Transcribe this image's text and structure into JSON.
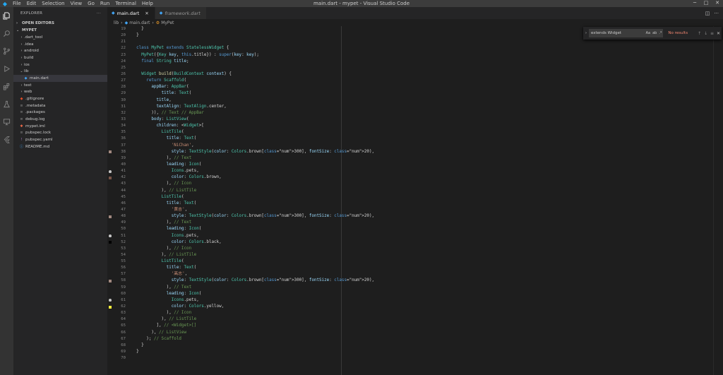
{
  "window": {
    "title": "main.dart - mypet - Visual Studio Code",
    "menu": [
      "File",
      "Edit",
      "Selection",
      "View",
      "Go",
      "Run",
      "Terminal",
      "Help"
    ]
  },
  "sidebar": {
    "header": "EXPLORER",
    "more": "···",
    "open_editors": "OPEN EDITORS",
    "project": "MYPET",
    "items": [
      {
        "label": ".dart_tool",
        "kind": "folder"
      },
      {
        "label": ".idea",
        "kind": "folder"
      },
      {
        "label": "android",
        "kind": "folder"
      },
      {
        "label": "build",
        "kind": "folder"
      },
      {
        "label": "ios",
        "kind": "folder"
      },
      {
        "label": "lib",
        "kind": "folder-open"
      },
      {
        "label": "main.dart",
        "kind": "dart"
      },
      {
        "label": "test",
        "kind": "folder"
      },
      {
        "label": "web",
        "kind": "folder"
      },
      {
        "label": ".gitignore",
        "kind": "git"
      },
      {
        "label": ".metadata",
        "kind": "file"
      },
      {
        "label": ".packages",
        "kind": "file"
      },
      {
        "label": "debug.log",
        "kind": "file"
      },
      {
        "label": "mypet.iml",
        "kind": "iml"
      },
      {
        "label": "pubspec.lock",
        "kind": "file"
      },
      {
        "label": "pubspec.yaml",
        "kind": "yaml"
      },
      {
        "label": "README.md",
        "kind": "info"
      }
    ]
  },
  "tabs": [
    {
      "label": "main.dart",
      "active": true
    },
    {
      "label": "framework.dart",
      "active": false
    }
  ],
  "breadcrumb": [
    "lib",
    "main.dart",
    "MyPet"
  ],
  "find": {
    "query": "extends Widget",
    "opt_case": "Aa",
    "opt_word": "ab",
    "opt_regex": ".*",
    "result": "No results"
  },
  "editor": {
    "line_numbers": [
      "19",
      "20",
      "21",
      "22",
      "23",
      "24",
      "25",
      "26",
      "27",
      "28",
      "29",
      "30",
      "31",
      "32",
      "33",
      "34",
      "35",
      "36",
      "37",
      "38",
      "39",
      "40",
      "41",
      "42",
      "43",
      "44",
      "45",
      "46",
      "47",
      "48",
      "49",
      "50",
      "51",
      "52",
      "53",
      "54",
      "55",
      "56",
      "57",
      "58",
      "59",
      "60",
      "61",
      "62",
      "63",
      "64",
      "65",
      "66",
      "67",
      "68",
      "69",
      "70"
    ],
    "lines": [
      "    }",
      "  }",
      "",
      "  class MyPet extends StatelessWidget {",
      "    MyPet({Key key, this.title}) : super(key: key);",
      "    final String title;",
      "",
      "    Widget build(BuildContext context) {",
      "      return Scaffold(",
      "        appBar: AppBar(",
      "            title: Text(",
      "          title,",
      "          textAlign: TextAlign.center,",
      "        )), // Text // AppBar",
      "        body: ListView(",
      "          children: <Widget>[",
      "            ListTile(",
      "              title: Text(",
      "                'NiChan',",
      "                style: TextStyle(color: Colors.brown[300], fontSize: 20),",
      "              ), // Text",
      "              leading: Icon(",
      "                Icons.pets,",
      "                color: Colors.brown,",
      "              ), // Icon",
      "            ), // ListTile",
      "            ListTile(",
      "              title: Text(",
      "                '黄吉',",
      "                style: TextStyle(color: Colors.brown[300], fontSize: 20),",
      "              ), // Text",
      "              leading: Icon(",
      "                Icons.pets,",
      "                color: Colors.black,",
      "              ), // Icon",
      "            ), // ListTile",
      "            ListTile(",
      "              title: Text(",
      "                '高志',",
      "                style: TextStyle(color: Colors.brown[300], fontSize: 20),",
      "              ), // Text",
      "              leading: Icon(",
      "                Icons.pets,",
      "                color: Colors.yellow,",
      "              ), // Icon",
      "            ), // ListTile",
      "          ], // <Widget>[]",
      "        ), // ListView",
      "      ); // Scaffold",
      "    }",
      "  }",
      ""
    ],
    "gutter_decorations": {
      "38": {
        "color": "#a1887f",
        "icon": "color-swatch-icon"
      },
      "41": {
        "color": "#c5c5c5",
        "icon": "pet-icon"
      },
      "42": {
        "color": "#795548",
        "icon": "color-swatch-icon"
      },
      "48": {
        "color": "#a1887f",
        "icon": "color-swatch-icon"
      },
      "51": {
        "color": "#c5c5c5",
        "icon": "pet-icon"
      },
      "52": {
        "color": "#000000",
        "icon": "color-swatch-icon"
      },
      "58": {
        "color": "#a1887f",
        "icon": "color-swatch-icon"
      },
      "61": {
        "color": "#c5c5c5",
        "icon": "pet-icon"
      },
      "62": {
        "color": "#ffeb3b",
        "icon": "color-swatch-icon"
      }
    }
  },
  "theme": {
    "accent": "#007acc",
    "dart_blue": "#42a5f5",
    "error": "#f48771"
  }
}
